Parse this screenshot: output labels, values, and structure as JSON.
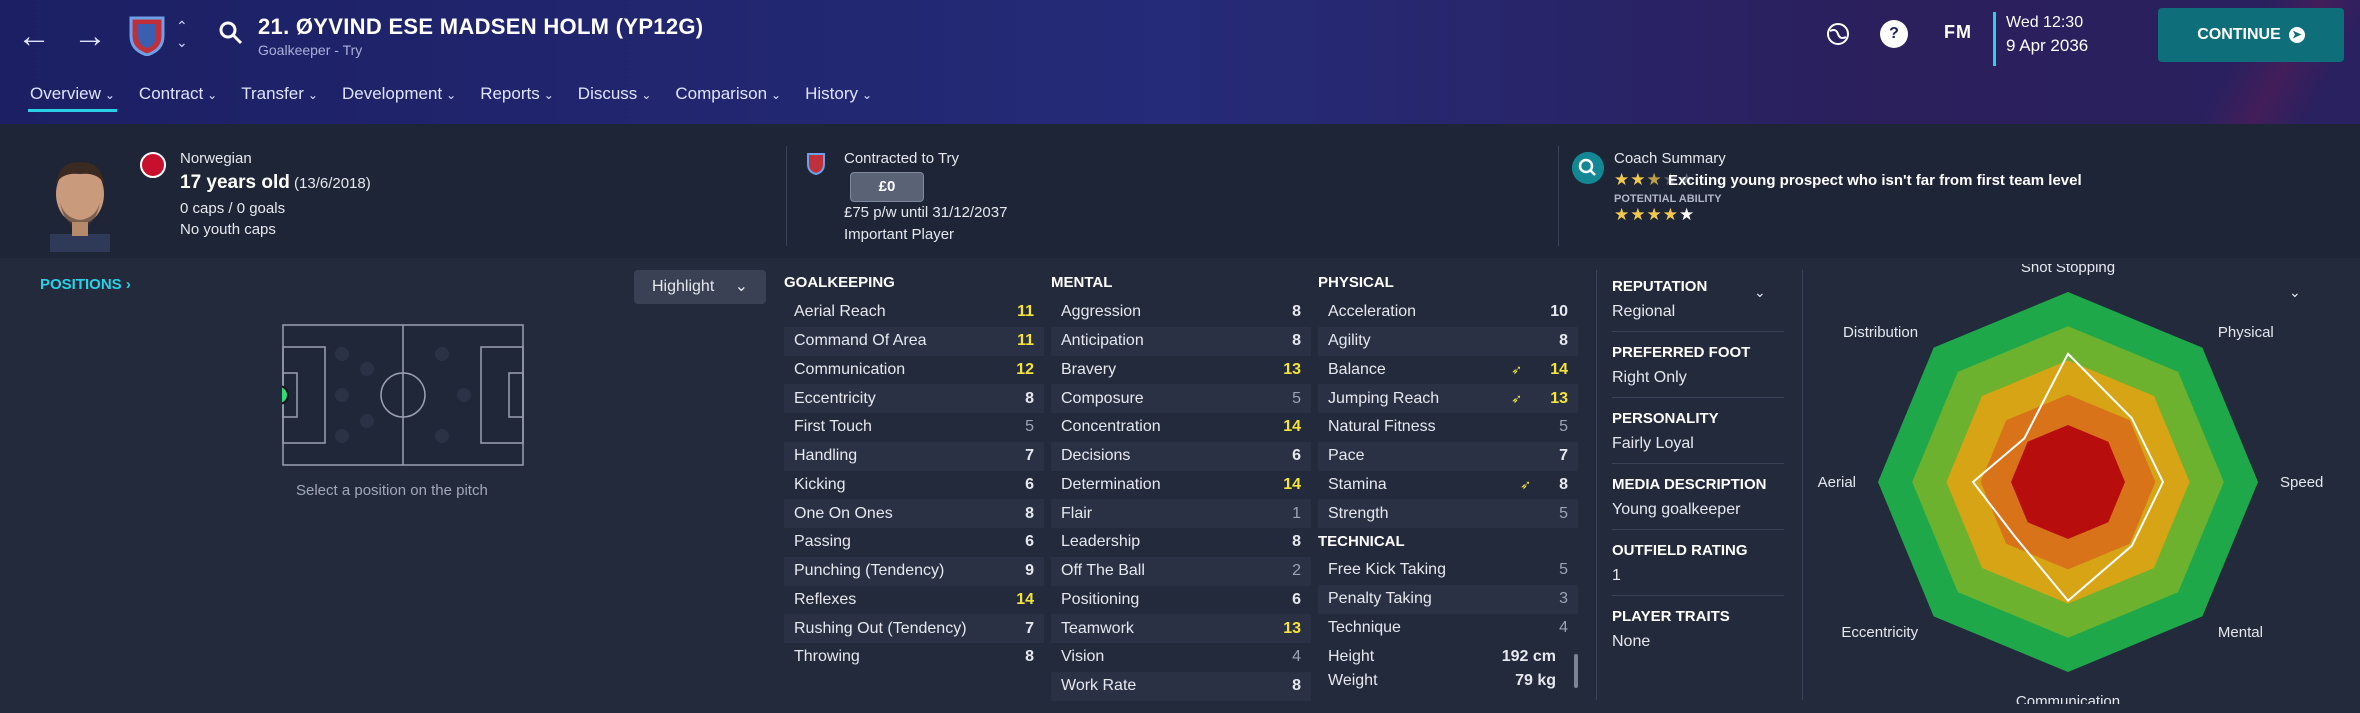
{
  "header": {
    "player_title": "21. ØYVIND ESE MADSEN HOLM (YP12G)",
    "player_subtitle": "Goalkeeper - Try",
    "fm_label": "FM",
    "date_time": "Wed 12:30",
    "date_date": "9 Apr 2036",
    "continue_label": "CONTINUE",
    "accent": "#2ad1e6"
  },
  "tabs": [
    {
      "label": "Overview"
    },
    {
      "label": "Contract"
    },
    {
      "label": "Transfer"
    },
    {
      "label": "Development"
    },
    {
      "label": "Reports"
    },
    {
      "label": "Discuss"
    },
    {
      "label": "Comparison"
    },
    {
      "label": "History"
    }
  ],
  "summary": {
    "nationality": "Norwegian",
    "age": "17 years old",
    "dob": "(13/6/2018)",
    "caps": "0 caps / 0 goals",
    "youth_caps": "No youth caps",
    "contract": "Contracted to Try",
    "value": "£0",
    "wage": "£75 p/w until 31/12/2037",
    "status": "Important Player",
    "coach_title": "Coach Summary",
    "coach_text": "Exciting young prospect who isn't far from first team level",
    "potential_label": "POTENTIAL ABILITY",
    "current_stars": 2.5,
    "potential_stars": 4.5
  },
  "positions": {
    "title": "POSITIONS",
    "highlight": "Highlight",
    "caption": "Select a position on the pitch"
  },
  "goalkeeping": {
    "title": "GOALKEEPING",
    "rows": [
      {
        "name": "Aerial Reach",
        "value": "11",
        "hl": "yellow"
      },
      {
        "name": "Command Of Area",
        "value": "11",
        "hl": "yellow"
      },
      {
        "name": "Communication",
        "value": "12",
        "hl": "yellow"
      },
      {
        "name": "Eccentricity",
        "value": "8",
        "hl": ""
      },
      {
        "name": "First Touch",
        "value": "5",
        "hl": "muted"
      },
      {
        "name": "Handling",
        "value": "7",
        "hl": ""
      },
      {
        "name": "Kicking",
        "value": "6",
        "hl": ""
      },
      {
        "name": "One On Ones",
        "value": "8",
        "hl": ""
      },
      {
        "name": "Passing",
        "value": "6",
        "hl": ""
      },
      {
        "name": "Punching (Tendency)",
        "value": "9",
        "hl": ""
      },
      {
        "name": "Reflexes",
        "value": "14",
        "hl": "yellow"
      },
      {
        "name": "Rushing Out (Tendency)",
        "value": "7",
        "hl": ""
      },
      {
        "name": "Throwing",
        "value": "8",
        "hl": ""
      }
    ]
  },
  "mental": {
    "title": "MENTAL",
    "rows": [
      {
        "name": "Aggression",
        "value": "8",
        "hl": ""
      },
      {
        "name": "Anticipation",
        "value": "8",
        "hl": ""
      },
      {
        "name": "Bravery",
        "value": "13",
        "hl": "yellow"
      },
      {
        "name": "Composure",
        "value": "5",
        "hl": "muted"
      },
      {
        "name": "Concentration",
        "value": "14",
        "hl": "yellow"
      },
      {
        "name": "Decisions",
        "value": "6",
        "hl": ""
      },
      {
        "name": "Determination",
        "value": "14",
        "hl": "yellow"
      },
      {
        "name": "Flair",
        "value": "1",
        "hl": "muted"
      },
      {
        "name": "Leadership",
        "value": "8",
        "hl": ""
      },
      {
        "name": "Off The Ball",
        "value": "2",
        "hl": "muted"
      },
      {
        "name": "Positioning",
        "value": "6",
        "hl": ""
      },
      {
        "name": "Teamwork",
        "value": "13",
        "hl": "yellow"
      },
      {
        "name": "Vision",
        "value": "4",
        "hl": "muted"
      },
      {
        "name": "Work Rate",
        "value": "8",
        "hl": ""
      }
    ]
  },
  "physical": {
    "title": "PHYSICAL",
    "rows": [
      {
        "name": "Acceleration",
        "value": "10",
        "hl": "",
        "up": false
      },
      {
        "name": "Agility",
        "value": "8",
        "hl": "",
        "up": false
      },
      {
        "name": "Balance",
        "value": "14",
        "hl": "yellow",
        "up": true
      },
      {
        "name": "Jumping Reach",
        "value": "13",
        "hl": "yellow",
        "up": true
      },
      {
        "name": "Natural Fitness",
        "value": "5",
        "hl": "muted",
        "up": false
      },
      {
        "name": "Pace",
        "value": "7",
        "hl": "",
        "up": false
      },
      {
        "name": "Stamina",
        "value": "8",
        "hl": "",
        "up": true
      },
      {
        "name": "Strength",
        "value": "5",
        "hl": "muted",
        "up": false
      }
    ]
  },
  "technical": {
    "title": "TECHNICAL",
    "rows": [
      {
        "name": "Free Kick Taking",
        "value": "5",
        "hl": "muted"
      },
      {
        "name": "Penalty Taking",
        "value": "3",
        "hl": "muted"
      },
      {
        "name": "Technique",
        "value": "4",
        "hl": "muted"
      }
    ],
    "height_label": "Height",
    "height_value": "192 cm",
    "weight_label": "Weight",
    "weight_value": "79 kg"
  },
  "info": [
    {
      "label": "REPUTATION",
      "value": "Regional"
    },
    {
      "label": "PREFERRED FOOT",
      "value": "Right Only"
    },
    {
      "label": "PERSONALITY",
      "value": "Fairly Loyal"
    },
    {
      "label": "MEDIA DESCRIPTION",
      "value": "Young goalkeeper"
    },
    {
      "label": "OUTFIELD RATING",
      "value": "1"
    },
    {
      "label": "PLAYER TRAITS",
      "value": "None"
    }
  ],
  "radar": {
    "labels": [
      "Shot Stopping",
      "Physical",
      "Speed",
      "Mental",
      "Communication",
      "Eccentricity",
      "Aerial",
      "Distribution"
    ],
    "values": [
      13.5,
      9.5,
      10.0,
      9.5,
      12.5,
      8.0,
      10.0,
      6.5
    ],
    "max": 20
  }
}
